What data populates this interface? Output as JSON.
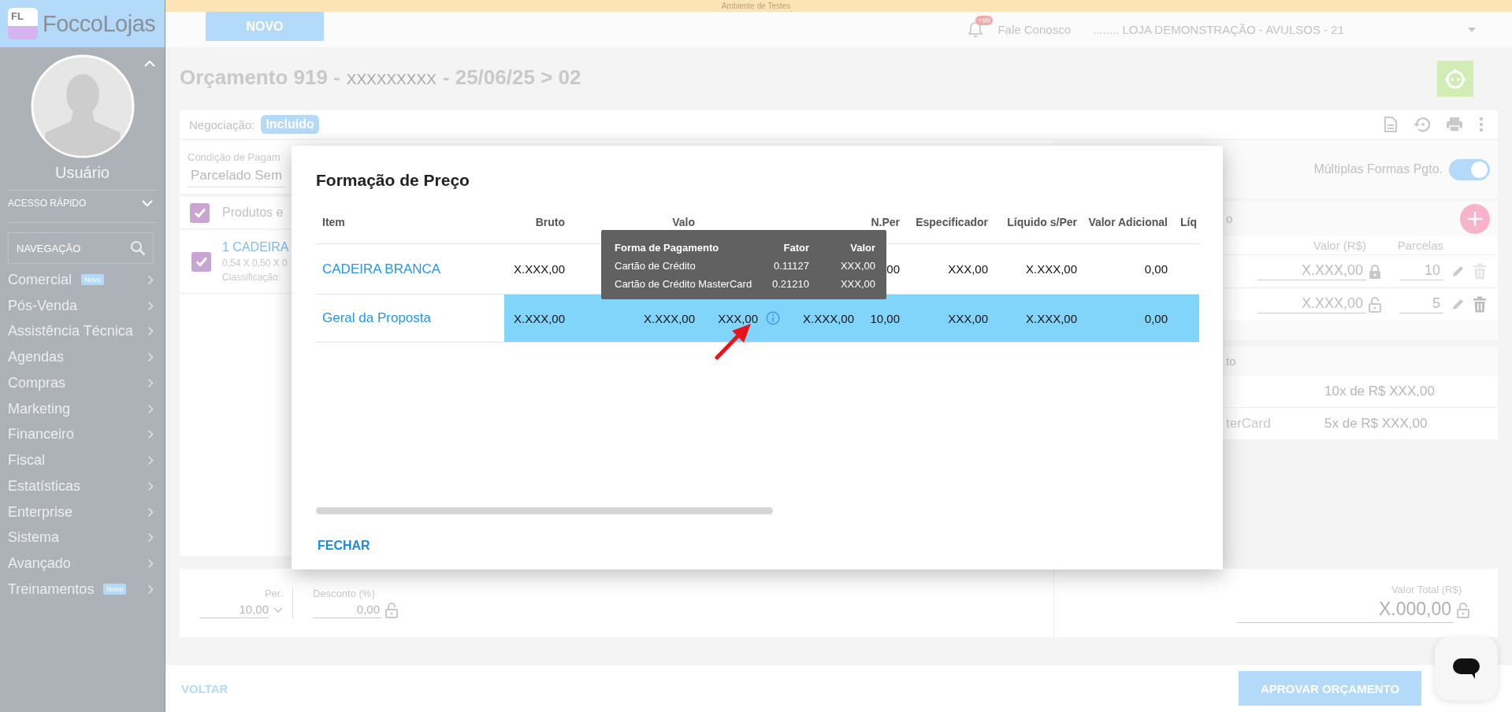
{
  "sidebar": {
    "logo": {
      "initials": "FL",
      "name": "FoccoLojas"
    },
    "user_name": "Usuário",
    "quick_access": {
      "label": "ACESSO RÁPIDO",
      "expanded": false
    },
    "nav_search": {
      "placeholder": "NAVEGAÇÃO"
    },
    "items": [
      {
        "label": "Comercial",
        "badge": "Novo"
      },
      {
        "label": "Pós-Venda"
      },
      {
        "label": "Assistência Técnica"
      },
      {
        "label": "Agendas"
      },
      {
        "label": "Compras"
      },
      {
        "label": "Marketing"
      },
      {
        "label": "Financeiro"
      },
      {
        "label": "Fiscal"
      },
      {
        "label": "Estatísticas"
      },
      {
        "label": "Enterprise"
      },
      {
        "label": "Sistema"
      },
      {
        "label": "Avançado"
      },
      {
        "label": "Treinamentos",
        "badge": "Novo"
      }
    ]
  },
  "environment_banner": "Ambiente de Testes",
  "header": {
    "new_button": "NOVO",
    "notifications": "+99",
    "contact_link": "Fale Conosco",
    "store": "........ LOJA DEMONSTRAÇÃO - AVULSOS - 21"
  },
  "quote": {
    "title_parts": [
      "Orçamento 919 -",
      "XXXXXXXXX",
      "- 25/06/25 > 02"
    ],
    "negotiation": {
      "label": "Negociação:",
      "status": "Incluído"
    },
    "payment_condition": {
      "label": "Condição de Pagam",
      "value": "Parcelado Sem"
    },
    "products": {
      "header": {
        "label": "Produtos e",
        "checked": true
      },
      "items": [
        {
          "title": "1 CADEIRA",
          "dimensions": "0,54 X 0,50 X 0",
          "classification": "Classificação:",
          "checked": true
        }
      ]
    },
    "multiple_payments": {
      "label": "Múltiplas Formas Pgto.",
      "on": true
    },
    "payments": {
      "title": "o",
      "columns": [
        "Valor (R$)",
        "Parcelas"
      ],
      "rows": [
        {
          "value": "X.XXX,00",
          "locked": true,
          "installments": "10",
          "delete_disabled": true
        },
        {
          "value": "X.XXX,00",
          "locked": false,
          "installments": "5",
          "delete_disabled": false
        }
      ]
    },
    "installments_summary": {
      "title": "to",
      "rows": [
        {
          "text": "10x de R$ XXX,00"
        },
        {
          "method": "terCard",
          "text": "5x de R$ XXX,00"
        }
      ]
    },
    "totals": {
      "period": {
        "label": "Per.",
        "value": "10,00"
      },
      "discount": {
        "label": "Desconto (%)",
        "value": "0,00",
        "locked": false
      },
      "total": {
        "label": "Valor Total (R$)",
        "value": "X.000,00",
        "locked": false
      }
    }
  },
  "footer": {
    "back": "VOLTAR",
    "approve": "APROVAR ORÇAMENTO"
  },
  "modal": {
    "title": "Formação de Preço",
    "table": {
      "columns": [
        "Item",
        "Bruto",
        "Valo",
        null,
        null,
        "N.Per",
        "Especificador",
        "Líquido s/Per",
        "Valor Adicional",
        "Líq"
      ],
      "rows": [
        {
          "selected": false,
          "cells": [
            "CADEIRA BRANCA",
            "X.XXX,00",
            null,
            null,
            null,
            "00",
            "XXX,00",
            "X.XXX,00",
            "0,00",
            null
          ]
        },
        {
          "selected": true,
          "cells": [
            "Geral da Proposta",
            "X.XXX,00",
            "X.XXX,00",
            {
              "text": "XXX,00",
              "kind": "info"
            },
            "X.XXX,00",
            "10,00",
            "XXX,00",
            "X.XXX,00",
            "0,00",
            null
          ]
        }
      ]
    },
    "tooltip": {
      "columns": [
        "Forma de Pagamento",
        "Fator",
        "Valor"
      ],
      "rows": [
        [
          "Cartão de Crédito",
          "0.11127",
          "XXX,00"
        ],
        [
          "Cartão de Crédito MasterCard",
          "0.21210",
          "XXX,00"
        ]
      ]
    },
    "close_button": "FECHAR"
  }
}
